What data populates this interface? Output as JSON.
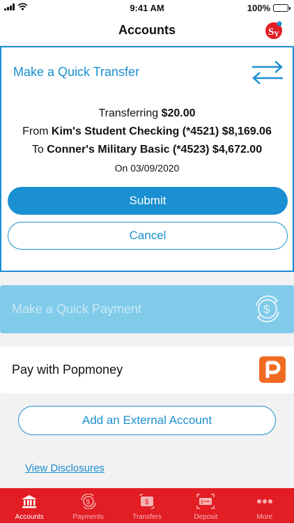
{
  "status_bar": {
    "time": "9:41 AM",
    "battery": "100%"
  },
  "header": {
    "title": "Accounts",
    "logo_text": "SY"
  },
  "quick_transfer": {
    "title": "Make a Quick Transfer",
    "transferring_label": "Transferring",
    "amount": "$20.00",
    "from_label": "From",
    "from_account": "Kim's Student Checking (*4521) $8,169.06",
    "to_label": "To",
    "to_account": "Conner's Military Basic (*4523) $4,672.00",
    "date_text": "On 03/09/2020",
    "submit_label": "Submit",
    "cancel_label": "Cancel"
  },
  "quick_payment": {
    "title": "Make a Quick Payment"
  },
  "popmoney": {
    "label": "Pay with Popmoney",
    "icon_letter": "P"
  },
  "external_account": {
    "label": "Add an External Account"
  },
  "disclosures": {
    "label": "View Disclosures"
  },
  "tabs": [
    {
      "label": "Accounts",
      "icon": "bank-icon",
      "active": true
    },
    {
      "label": "Payments",
      "icon": "dollar-cycle-icon",
      "active": false
    },
    {
      "label": "Transfers",
      "icon": "transfer-icon",
      "active": false
    },
    {
      "label": "Deposit",
      "icon": "check-deposit-icon",
      "active": false
    },
    {
      "label": "More",
      "icon": "more-dots-icon",
      "active": false
    }
  ],
  "colors": {
    "accent_blue": "#1a8fd1",
    "tab_bar_red": "#e21d24",
    "payment_disabled_blue": "#80cbea",
    "popmoney_orange": "#f06b22"
  }
}
